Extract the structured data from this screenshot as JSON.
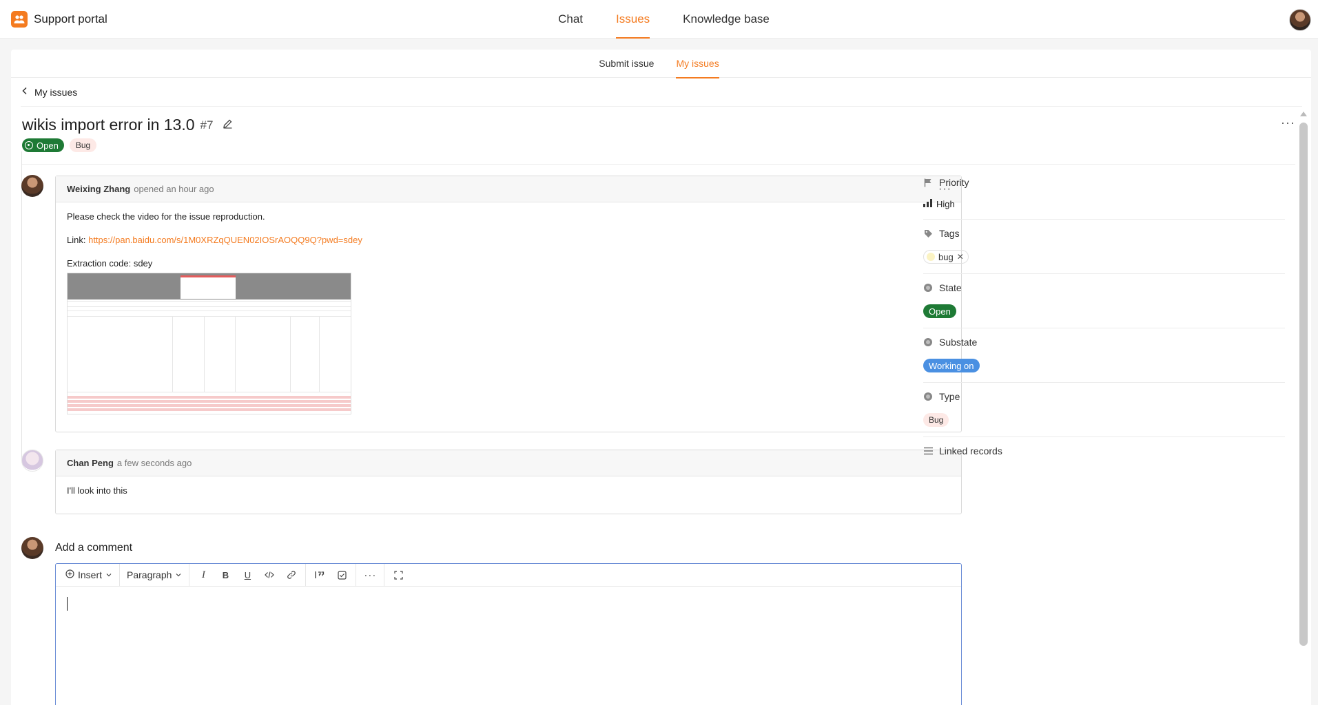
{
  "header": {
    "app_name": "Support portal",
    "nav": [
      "Chat",
      "Issues",
      "Knowledge base"
    ],
    "active_nav": "Issues"
  },
  "subtabs": [
    "Submit issue",
    "My issues"
  ],
  "back_label": "My issues",
  "issue": {
    "title": "wikis import error in 13.0",
    "number": "#7",
    "state": "Open",
    "type": "Bug"
  },
  "comments": [
    {
      "author": "Weixing Zhang",
      "meta": "opened an hour ago",
      "line1": "Please check the video for the issue reproduction.",
      "link_label": "Link:",
      "link": "https://pan.baidu.com/s/1M0XRZqQUEN02IOSrAOQQ9Q?pwd=sdey",
      "code_line": "Extraction code: sdey"
    },
    {
      "author": "Chan Peng",
      "meta": "a few seconds ago",
      "text": "I'll look into this"
    }
  ],
  "add_comment": {
    "title": "Add a comment",
    "insert": "Insert",
    "paragraph": "Paragraph"
  },
  "sidebar": {
    "priority_label": "Priority",
    "priority_value": "High",
    "tags_label": "Tags",
    "tag": "bug",
    "state_label": "State",
    "state_value": "Open",
    "substate_label": "Substate",
    "substate_value": "Working on",
    "type_label": "Type",
    "type_value": "Bug",
    "linked_label": "Linked records"
  },
  "colors": {
    "accent": "#f47b20",
    "open_green": "#1e7a35",
    "working_blue": "#4a90e2",
    "bug_pink": "#fde9e6"
  }
}
